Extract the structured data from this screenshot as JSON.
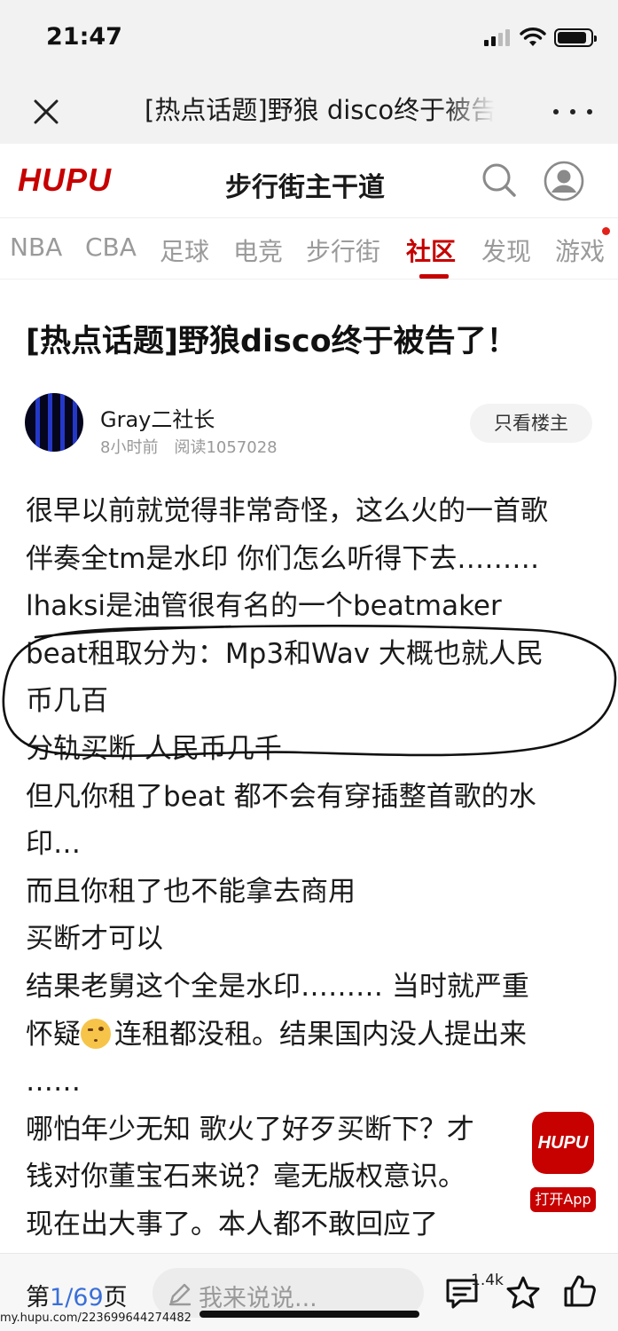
{
  "status_bar": {
    "time": "21:47"
  },
  "browser_bar": {
    "page_title": "[热点话题]野狼 disco终于被告了！"
  },
  "header": {
    "logo_text": "HUPU",
    "section_title": "步行街主干道"
  },
  "nav": {
    "tabs": [
      {
        "label": "NBA",
        "active": false
      },
      {
        "label": "CBA",
        "active": false
      },
      {
        "label": "足球",
        "active": false
      },
      {
        "label": "电竞",
        "active": false
      },
      {
        "label": "步行街",
        "active": false
      },
      {
        "label": "社区",
        "active": true
      },
      {
        "label": "发现",
        "active": false
      },
      {
        "label": "游戏",
        "active": false
      }
    ]
  },
  "post": {
    "title": "[热点话题]野狼disco终于被告了！",
    "author": {
      "name": "Gray二社长",
      "time": "8小时前",
      "reads": "阅读1057028"
    },
    "op_only_label": "只看楼主",
    "lines": [
      "很早以前就觉得非常奇怪，这么火的一首歌",
      "伴奏全tm是水印 你们怎么听得下去………",
      "lhaksi是油管很有名的一个beatmaker",
      "beat租取分为：Mp3和Wav 大概也就人民",
      "币几百",
      "分轨买断 人民币几千",
      "但凡你租了beat 都不会有穿插整首歌的水",
      "印…",
      "而且你租了也不能拿去商用",
      "买断才可以",
      "结果老舅这个全是水印……… 当时就严重",
      "怀疑",
      "连租都没租。结果国内没人提出来",
      "……",
      "哪怕年少无知 歌火了好歹买断下？才",
      "钱对你董宝石来说？毫无版权意识。",
      "现在出大事了。本人都不敢回应了"
    ]
  },
  "app_promo": {
    "logo_text": "HUPU",
    "open_app_label": "打开App"
  },
  "bottom_bar": {
    "page_prefix": "第",
    "page_current": "1",
    "page_total": "/69",
    "page_suffix": "页",
    "comment_placeholder": "我来说说...",
    "reply_count": "1.4k"
  },
  "watermark": "my.hupu.com/223699644274482",
  "colors": {
    "brand_red": "#c60100",
    "page_link_blue": "#3a6fd8"
  }
}
